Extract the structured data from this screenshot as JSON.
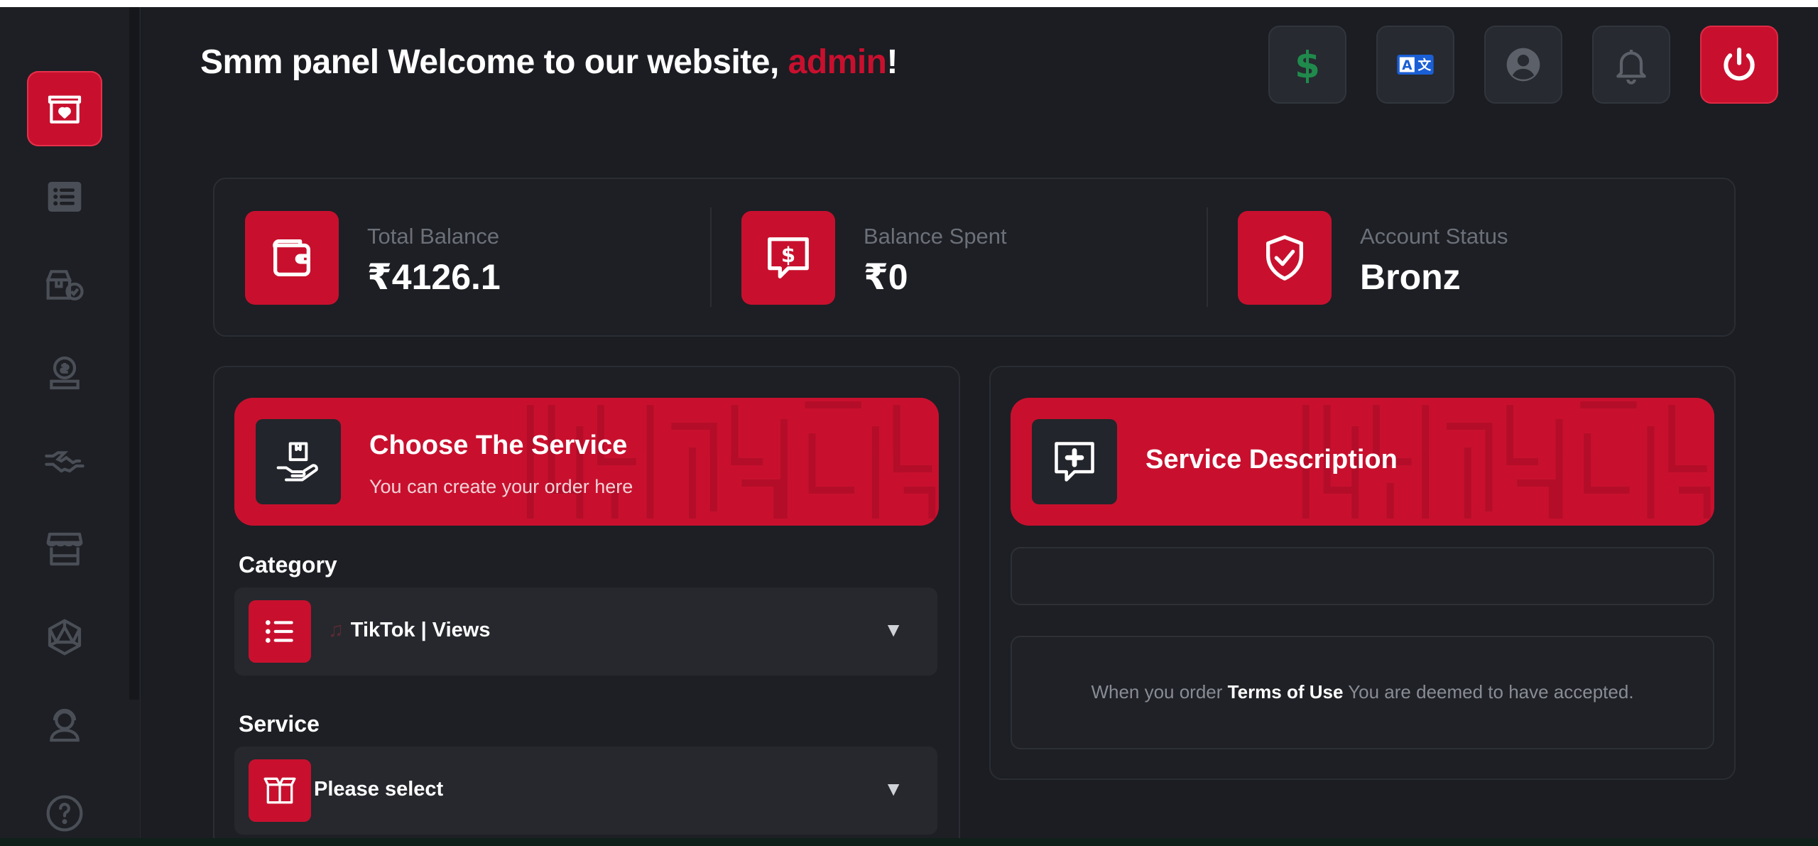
{
  "header": {
    "welcome_prefix": "Smm panel Welcome to our website, ",
    "username": "admin",
    "welcome_suffix": "!"
  },
  "header_buttons": [
    {
      "name": "add-funds",
      "icon": "dollar-icon"
    },
    {
      "name": "language",
      "icon": "translate-icon"
    },
    {
      "name": "profile",
      "icon": "user-circle-icon"
    },
    {
      "name": "notifications",
      "icon": "bell-icon"
    },
    {
      "name": "logout",
      "icon": "power-icon"
    }
  ],
  "sidebar": {
    "items": [
      {
        "name": "new-order",
        "icon": "box-heart-icon",
        "active": true
      },
      {
        "name": "orders",
        "icon": "list-icon"
      },
      {
        "name": "mass-order",
        "icon": "boxes-check-icon"
      },
      {
        "name": "add-funds",
        "icon": "money-hand-icon"
      },
      {
        "name": "affiliates",
        "icon": "handshake-icon"
      },
      {
        "name": "services",
        "icon": "store-icon"
      },
      {
        "name": "api",
        "icon": "dice-icon"
      },
      {
        "name": "support",
        "icon": "support-agent-icon"
      },
      {
        "name": "faq",
        "icon": "question-icon"
      }
    ]
  },
  "stats": [
    {
      "label": "Total Balance",
      "value": "₹4126.1",
      "icon": "wallet-icon"
    },
    {
      "label": "Balance Spent",
      "value": "₹0",
      "icon": "dollar-chat-icon"
    },
    {
      "label": "Account Status",
      "value": "Bronz",
      "icon": "shield-check-icon"
    }
  ],
  "order_panel": {
    "title": "Choose The Service",
    "subtitle": "You can create your order here",
    "category_label": "Category",
    "category_value": "TikTok | Views",
    "category_note_glyph": "♫",
    "service_label": "Service",
    "service_value": "Please select",
    "arrow": "▼"
  },
  "description_panel": {
    "title": "Service Description",
    "terms_prefix": "When you order ",
    "terms_link": "Terms of Use",
    "terms_suffix": " You are deemed to have accepted."
  },
  "colors": {
    "accent": "#c8102e",
    "background": "#1b1d22",
    "panel": "#1d1f24",
    "dollar_green": "#1f8a4c",
    "translate_blue": "#1a5fd6"
  }
}
